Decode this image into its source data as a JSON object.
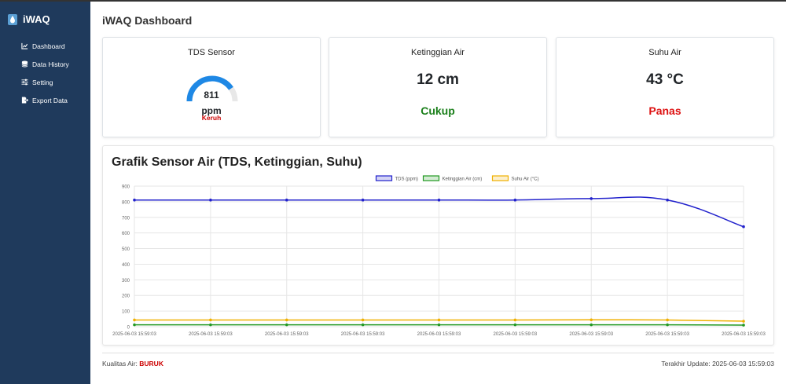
{
  "app": {
    "name": "iWAQ"
  },
  "sidebar": {
    "items": [
      {
        "label": "Dashboard",
        "icon": "chart-line-icon"
      },
      {
        "label": "Data History",
        "icon": "database-icon"
      },
      {
        "label": "Setting",
        "icon": "sliders-icon"
      },
      {
        "label": "Export Data",
        "icon": "file-export-icon"
      }
    ]
  },
  "header": {
    "title": "iWAQ Dashboard"
  },
  "cards": {
    "tds": {
      "title": "TDS Sensor",
      "value": "811",
      "unit": "ppm",
      "status": "Keruh",
      "gauge_fraction": 0.81
    },
    "level": {
      "title": "Ketinggian Air",
      "value": "12 cm",
      "status": "Cukup"
    },
    "temp": {
      "title": "Suhu Air",
      "value": "43 °C",
      "status": "Panas"
    }
  },
  "colors": {
    "sidebar": "#1f3a5c",
    "tds": "#2222cc",
    "level": "#229922",
    "temp": "#f0b000",
    "gauge": "#1e88e5",
    "bad": "#dd1111",
    "good": "#1a7f1a"
  },
  "chart_data": {
    "type": "line",
    "title": "Grafik Sensor Air (TDS, Ketinggian, Suhu)",
    "categories": [
      "2025-06-03 15:59:03",
      "2025-06-03 15:59:03",
      "2025-06-03 15:59:03",
      "2025-06-03 15:59:03",
      "2025-06-03 15:59:03",
      "2025-06-03 15:59:03",
      "2025-06-03 15:59:03",
      "2025-06-03 15:59:03",
      "2025-06-03 15:59:03"
    ],
    "series": [
      {
        "name": "TDS (ppm)",
        "color": "#2222cc",
        "values": [
          811,
          811,
          811,
          811,
          811,
          811,
          820,
          811,
          640
        ]
      },
      {
        "name": "Ketinggian Air (cm)",
        "color": "#229922",
        "values": [
          12,
          12,
          12,
          12,
          12,
          12,
          12,
          12,
          10
        ]
      },
      {
        "name": "Suhu Air (°C)",
        "color": "#f0b000",
        "values": [
          43,
          43,
          43,
          43,
          43,
          43,
          44,
          43,
          35
        ]
      }
    ],
    "ylim": [
      0,
      900
    ],
    "yticks": [
      "0",
      "100",
      "200",
      "300",
      "400",
      "500",
      "600",
      "700",
      "800",
      "900"
    ],
    "grid": true,
    "legend": "top-center"
  },
  "footer": {
    "quality_label": "Kualitas Air:",
    "quality_value": "BURUK",
    "update_text": "Terakhir Update: 2025-06-03 15:59:03"
  }
}
